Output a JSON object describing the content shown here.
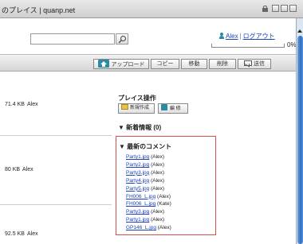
{
  "window": {
    "title": "のプレイス | quanp.net"
  },
  "header": {
    "search": {
      "value": "",
      "placeholder": ""
    },
    "user_name": "Alex",
    "logout_label": "ログアウト",
    "separator": "|",
    "quota_percent": "0%",
    "quota_fraction": 0.0
  },
  "toolbar": {
    "upload": "アップロード",
    "copy": "コピー",
    "move": "移動",
    "delete": "削除",
    "send": "送信"
  },
  "files": [
    {
      "size": "71.4 KB",
      "owner": "Alex"
    },
    {
      "size": "80 KB",
      "owner": "Alex"
    },
    {
      "size": "92.5 KB",
      "owner": "Alex"
    }
  ],
  "panel": {
    "title": "プレイス操作",
    "new_folder": "新規作成",
    "edit": "編 修",
    "latest_info": "▼ 新着情報 (0)",
    "latest_comments": "▼ 最新のコメント",
    "comments": [
      {
        "file": "Party1.jpg",
        "by": "(Alex)"
      },
      {
        "file": "Party2.jpg",
        "by": "(Alex)"
      },
      {
        "file": "Party3.jpg",
        "by": "(Alex)"
      },
      {
        "file": "Party4.jpg",
        "by": "(Alex)"
      },
      {
        "file": "Party5.jpg",
        "by": "(Alex)"
      },
      {
        "file": "FH006_L.jpg",
        "by": "(Alex)"
      },
      {
        "file": "FH006_L.jpg",
        "by": "(Kate)"
      },
      {
        "file": "Party3.jpg",
        "by": "(Alex)"
      },
      {
        "file": "Party1.jpg",
        "by": "(Alex)"
      },
      {
        "file": "GP146_L.jpg",
        "by": "(Alex)"
      }
    ]
  },
  "colors": {
    "link": "#1a3fbf",
    "comments_border": "#d0504a",
    "scroll_thumb": "#2f6cc3",
    "accent_icon": "#2a8aa8"
  },
  "icons": [
    "lock-icon",
    "search-icon",
    "user-icon",
    "home-icon",
    "mail-icon",
    "folder-icon",
    "edit-icon"
  ]
}
